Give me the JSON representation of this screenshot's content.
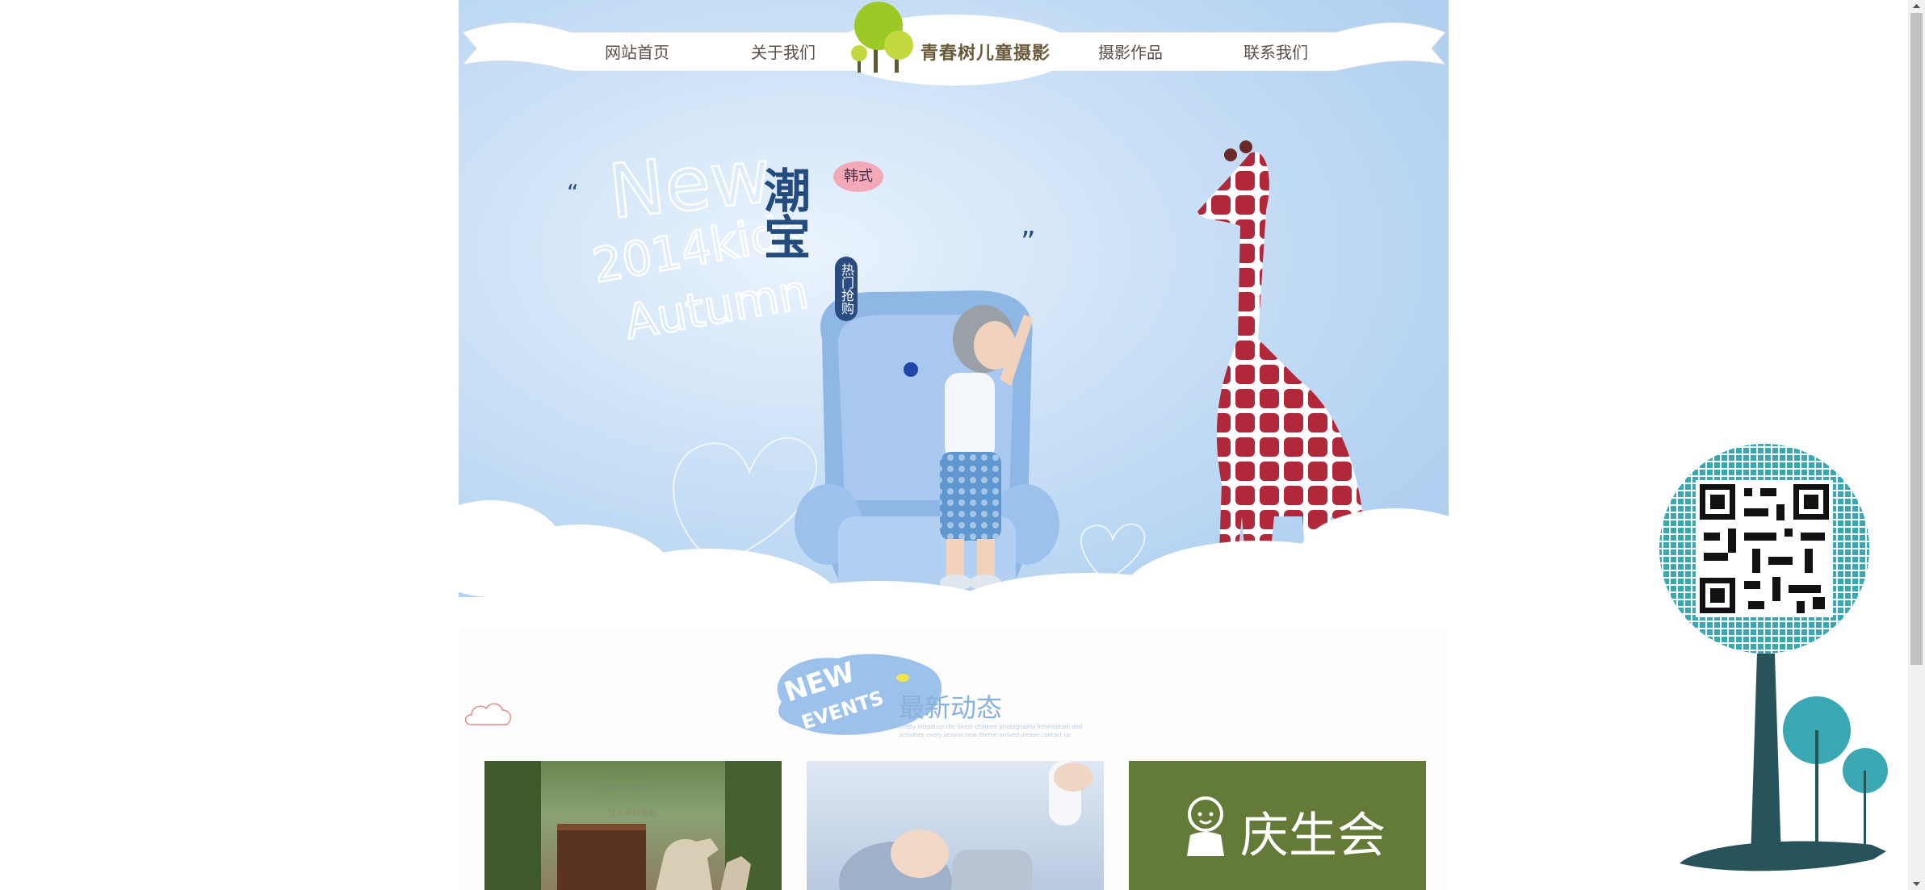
{
  "nav": {
    "items": [
      "网站首页",
      "关于我们",
      "摄影作品",
      "联系我们"
    ],
    "logo_text": "青春树儿童摄影"
  },
  "banner": {
    "en_line1": "New",
    "en_line2": "2014kids",
    "en_line3": "Autumn",
    "cn_title": "潮宝",
    "badge": "韩式",
    "hot_tag": "热门抢购"
  },
  "news": {
    "badge_en_1": "NEW",
    "badge_en_2": "EVENTS",
    "title": "最新动态",
    "subtitle": "kindly introduce the latest children photography information and activities every season new theme arrived please contact us"
  },
  "cards": [
    {
      "caption_en": "Jiawen Yunxiu",
      "caption_cn": "佳人孕妇摄影"
    },
    {
      "caption_en": "",
      "caption_cn": ""
    },
    {
      "caption_cn": "庆生会"
    }
  ],
  "colors": {
    "sky": "#b6d4f2",
    "nav_text": "#5a5048",
    "news_title": "#8ab1dc",
    "card3_bg": "#647a37",
    "qr_color": "#3aa8b3",
    "trunk": "#27545b"
  },
  "icons": {
    "qr": "qr-code-icon",
    "tree": "tree-icon",
    "cloud": "cloud-icon",
    "baby": "baby-icon"
  }
}
